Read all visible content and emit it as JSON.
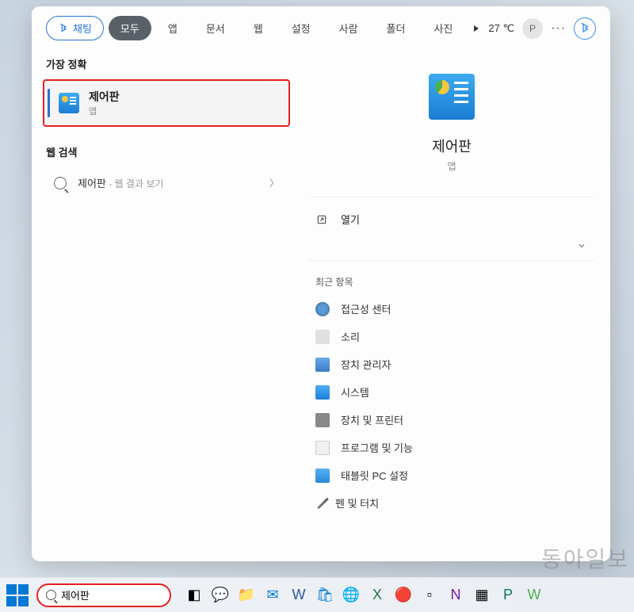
{
  "tabs": {
    "chat": "채팅",
    "all": "모두",
    "app": "앱",
    "doc": "문서",
    "web": "웹",
    "settings": "설정",
    "people": "사람",
    "folder": "폴더",
    "photo": "사진"
  },
  "topRight": {
    "temp": "27 ℃",
    "avatar": "P"
  },
  "leftPane": {
    "bestMatch": "가장 정확",
    "webSearch": "웹 검색",
    "result": {
      "title": "제어판",
      "sub": "앱"
    },
    "webItem": {
      "prefix": "제어판",
      "suffix": " - 웹 결과 보기"
    }
  },
  "preview": {
    "title": "제어판",
    "sub": "앱",
    "open": "열기",
    "recentLabel": "최근 항목",
    "recent": [
      "접근성 센터",
      "소리",
      "장치 관리자",
      "시스템",
      "장치 및 프린터",
      "프로그램 및 기능",
      "태블릿 PC 설정",
      "펜 및 터치"
    ]
  },
  "taskbar": {
    "searchValue": "제어판"
  },
  "watermark": "동아일보"
}
